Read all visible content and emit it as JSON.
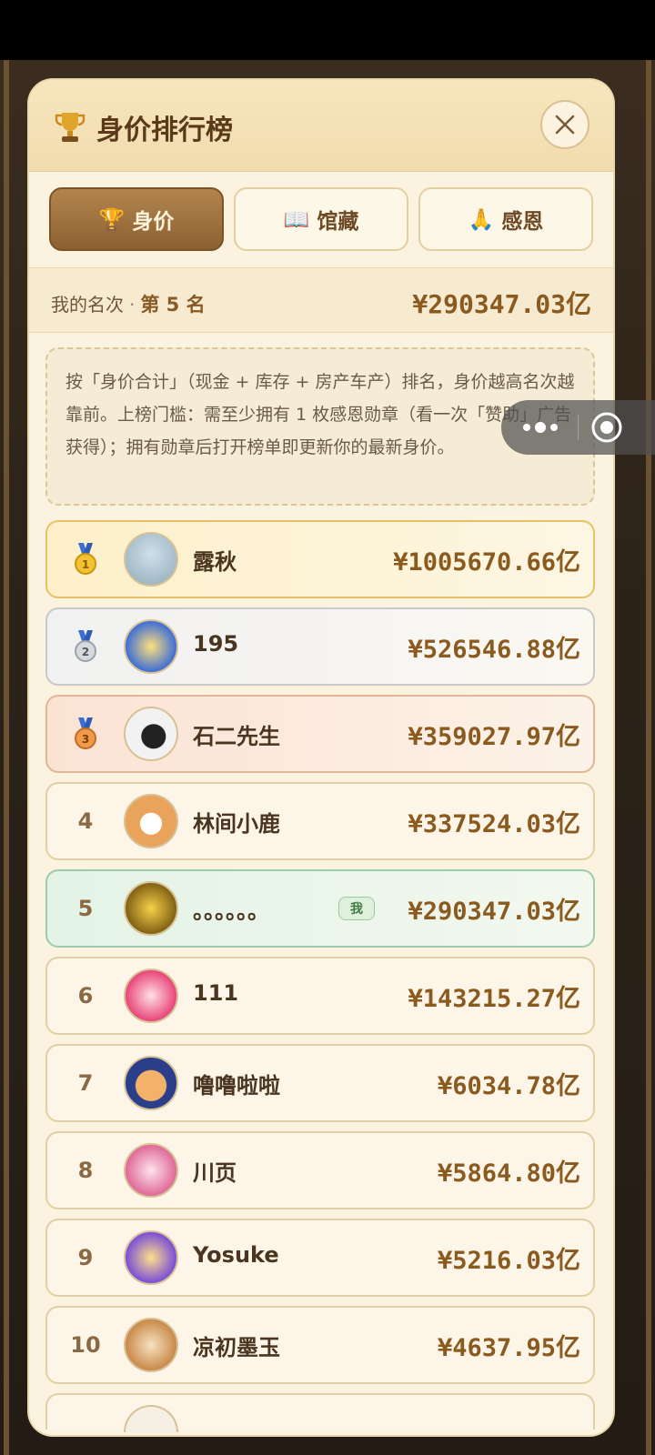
{
  "header": {
    "title": "身价排行榜"
  },
  "tabs": [
    {
      "icon": "🏆",
      "label": "身价",
      "active": true
    },
    {
      "icon": "📖",
      "label": "馆藏",
      "active": false
    },
    {
      "icon": "🙏",
      "label": "感恩",
      "active": false
    }
  ],
  "my_rank": {
    "label": "我的名次",
    "dot": "·",
    "rank_text": "第 5 名",
    "value": "¥290347.03亿"
  },
  "notice": "按「身价合计」（现金 + 库存 + 房产车产）排名，身价越高名次越靠前。上榜门槛：需至少拥有 1 枚感恩勋章（看一次「赞助」广告获得）；拥有勋章后打开榜单即更新你的最新身价。",
  "rows": [
    {
      "rank": "",
      "medal": "gold",
      "name": "露秋",
      "value": "¥1005670.66亿"
    },
    {
      "rank": "",
      "medal": "silver",
      "name": "195",
      "value": "¥526546.88亿"
    },
    {
      "rank": "",
      "medal": "bronze",
      "name": "石二先生",
      "value": "¥359027.97亿"
    },
    {
      "rank": "4",
      "name": "林间小鹿",
      "value": "¥337524.03亿"
    },
    {
      "rank": "5",
      "name": "。。。。。。",
      "value": "¥290347.03亿",
      "me_badge": "我"
    },
    {
      "rank": "6",
      "name": "111",
      "value": "¥143215.27亿"
    },
    {
      "rank": "7",
      "name": "噜噜啦啦",
      "value": "¥6034.78亿"
    },
    {
      "rank": "8",
      "name": "川页",
      "value": "¥5864.80亿"
    },
    {
      "rank": "9",
      "name": "Yosuke",
      "value": "¥5216.03亿"
    },
    {
      "rank": "10",
      "name": "凉初墨玉",
      "value": "¥4637.95亿"
    }
  ],
  "colors": {
    "accent": "#8a5a1e",
    "tab_active": "#a47540",
    "me_row": "#e3f3e6"
  }
}
